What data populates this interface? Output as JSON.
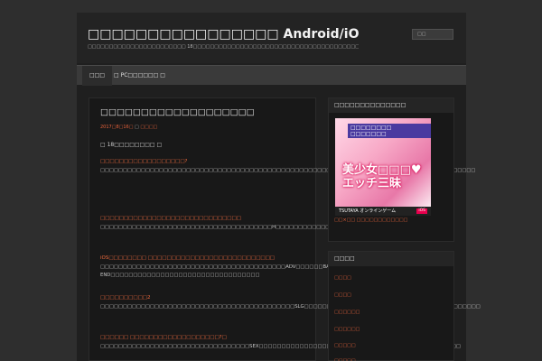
{
  "header": {
    "site_title": "□□□□□□□□□□□□□□□□ Android/iOS",
    "site_description": "□□□□□□□□□□□□□□□□□□□□□□□ 18□□□□□□□□□□□□□□□□□□□□□□□□□□□□□□□□□□□□□□□□□□□□□□□□□□",
    "search_label": "□□"
  },
  "nav": {
    "items": [
      {
        "label": "□□□"
      },
      {
        "label": "□ PC□□□□□□ □"
      }
    ]
  },
  "post": {
    "title": "□□□□□□□□□□□□□□□□□□□",
    "date": "2017□8□16□",
    "author": "□□□□",
    "rating": "□ 18□□□□□□□□ □",
    "sections": [
      {
        "heading": "□□□□□□□□□□□□□□□□□□?",
        "body": "□□□□□□□□□□□□□□□□□□□□□□□□□□□□□□□□□□□□□□□□□□□□□□□□□□□□□□□□□□□□□□□□□□□□□□□□□□□□□□□□□□□"
      },
      {
        "heading": "□□□□□□□□□□□□□□□□□□□□□□□□□□□□□□",
        "body": "□□□□□□□□□□□□□□□□□□□□□□□□□□□□□□□□□□□□□□H□□□□□□□□□□□□□AE□□□□□□□□□□□□□□□□□□□□□□□□"
      },
      {
        "heading": "iOS□□□□□□□□ □□□□□□□□□□□□□□□□□□□□□□□□□□□",
        "body": "□□□□□□□□□□□□□□□□□□□□□□□□□□□□□□□□□□□□□□□□□ADV□□□□□□BAD END□□□□□□□□□□□□□□□□□□□□□□□□□□□□□□□□□"
      },
      {
        "heading": "□□□□□□□□□□2",
        "body": "□□□□□□□□□□□□□□□□□□□□□□□□□□□□□□□□□□□□□□□□□□□SLG□□□□□□□□□□□□□□□□□□□□□□□□□□□□□□□□□□□□□□□"
      },
      {
        "heading": "□□□□□□ □□□□□□□□□□□□□□□□□□□?□",
        "body": "□□□□□□□□□□□□□□□□□□□□□□□□□□□□□□□□□SEX□□□□□□□□□□□□□□□□□2□□□□□□□□□□□□□□□□□□□□□□□□□□□"
      }
    ]
  },
  "sidebar": {
    "ad_widget": {
      "title": "□□□□□□□□□□□□□□",
      "banner_top": "□□□□□□□□ □□□□□□□",
      "banner_main": "美少女□□□♥ エッチ三昧",
      "banner_footer": "TSUTAYA オンラインゲーム",
      "banner_badge": "iOS",
      "caption": "□□×□□ □□□□□□□□□□□□"
    },
    "category_widget": {
      "title": "□□□□",
      "items": [
        "□□□□",
        "□□□□",
        "□□□□□□",
        "□□□□□□",
        "□□□□□",
        "□□□□□"
      ]
    }
  }
}
